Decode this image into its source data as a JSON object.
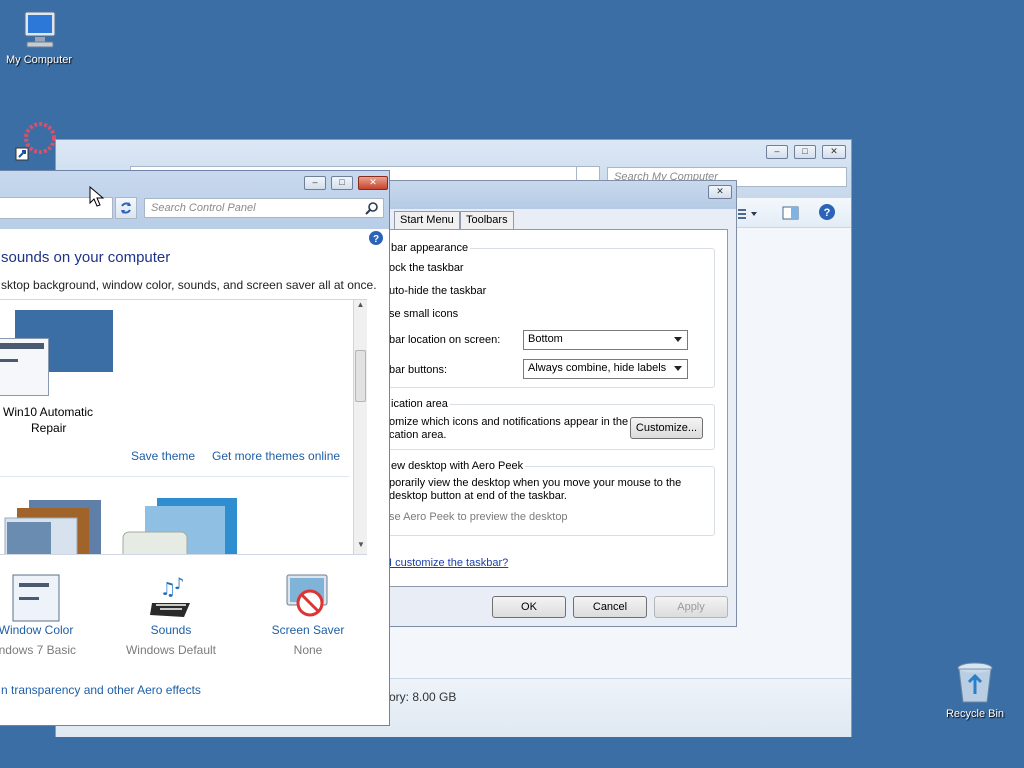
{
  "desktop": {
    "icons": [
      {
        "name": "My Computer"
      },
      {
        "name": "Recycle Bin"
      }
    ]
  },
  "explorer": {
    "search_placeholder": "Search My Computer",
    "memory_text": "ory: 8.00 GB"
  },
  "personalization": {
    "search_placeholder": "Search Control Panel",
    "heading": "sounds on your computer",
    "subtext": "sktop background, window color, sounds, and screen saver all at once.",
    "theme_name_line1": "Win10 Automatic",
    "theme_name_line2": "Repair",
    "save_theme": "Save theme",
    "get_more_themes": "Get more themes online",
    "window_color": {
      "label": "Window Color",
      "value": "indows 7 Basic"
    },
    "sounds": {
      "label": "Sounds",
      "value": "Windows Default"
    },
    "screen_saver": {
      "label": "Screen Saver",
      "value": "None"
    },
    "aero_link": "n transparency and other Aero effects"
  },
  "taskbar_properties": {
    "tabs": [
      "Start Menu",
      "Toolbars"
    ],
    "appearance_group": "bar appearance",
    "lock_taskbar": "ock the taskbar",
    "auto_hide": "uto-hide the taskbar",
    "small_icons": "se small icons",
    "location_label": "bar location on screen:",
    "location_value": "Bottom",
    "buttons_label": "bar buttons:",
    "buttons_value": "Always combine, hide labels",
    "notification_group": "ication area",
    "notification_text_1": "omize which icons and notifications appear in the",
    "notification_text_2": "cation area.",
    "customize_button": "Customize...",
    "aero_group": "ew desktop with Aero Peek",
    "aero_text_1": "porarily view the desktop when you move your mouse to the",
    "aero_text_2": "desktop button at end of the taskbar.",
    "aero_checkbox": "se Aero Peek to preview the desktop",
    "help_link": "I customize the taskbar?",
    "ok": "OK",
    "cancel": "Cancel",
    "apply": "Apply"
  }
}
